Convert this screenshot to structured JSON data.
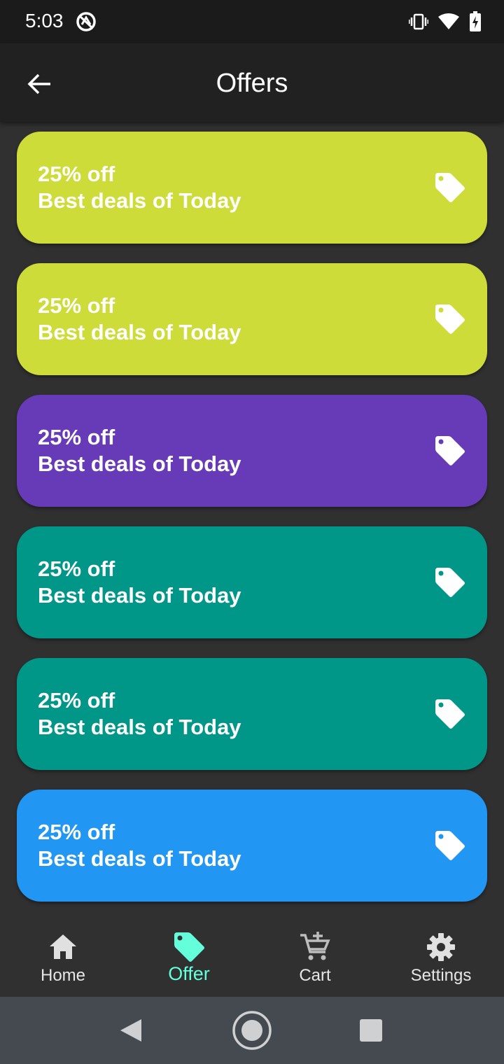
{
  "status_bar": {
    "time": "5:03",
    "icons": [
      "app-notification-icon",
      "vibrate-icon",
      "wifi-icon",
      "battery-charging-icon"
    ]
  },
  "app_bar": {
    "title": "Offers",
    "back_icon": "arrow-back-icon"
  },
  "offers": [
    {
      "line1": "25% off",
      "line2": "Best deals of Today",
      "color": "#cddc39",
      "icon": "tag-icon"
    },
    {
      "line1": "25% off",
      "line2": "Best deals of Today",
      "color": "#cddc39",
      "icon": "tag-icon"
    },
    {
      "line1": "25% off",
      "line2": "Best deals of Today",
      "color": "#673ab7",
      "icon": "tag-icon"
    },
    {
      "line1": "25% off",
      "line2": "Best deals of Today",
      "color": "#009688",
      "icon": "tag-icon"
    },
    {
      "line1": "25% off",
      "line2": "Best deals of Today",
      "color": "#009688",
      "icon": "tag-icon"
    },
    {
      "line1": "25% off",
      "line2": "Best deals of Today",
      "color": "#2196f3",
      "icon": "tag-icon"
    }
  ],
  "bottom_nav": {
    "items": [
      {
        "label": "Home",
        "icon": "home-icon",
        "active": false
      },
      {
        "label": "Offer",
        "icon": "tag-icon",
        "active": true
      },
      {
        "label": "Cart",
        "icon": "add-to-cart-icon",
        "active": false
      },
      {
        "label": "Settings",
        "icon": "gear-icon",
        "active": false
      }
    ],
    "active_color": "#64ffda",
    "inactive_color": "#e6e6e6"
  },
  "system_nav": {
    "icons": [
      "back-triangle-icon",
      "home-circle-icon",
      "recents-square-icon"
    ]
  }
}
